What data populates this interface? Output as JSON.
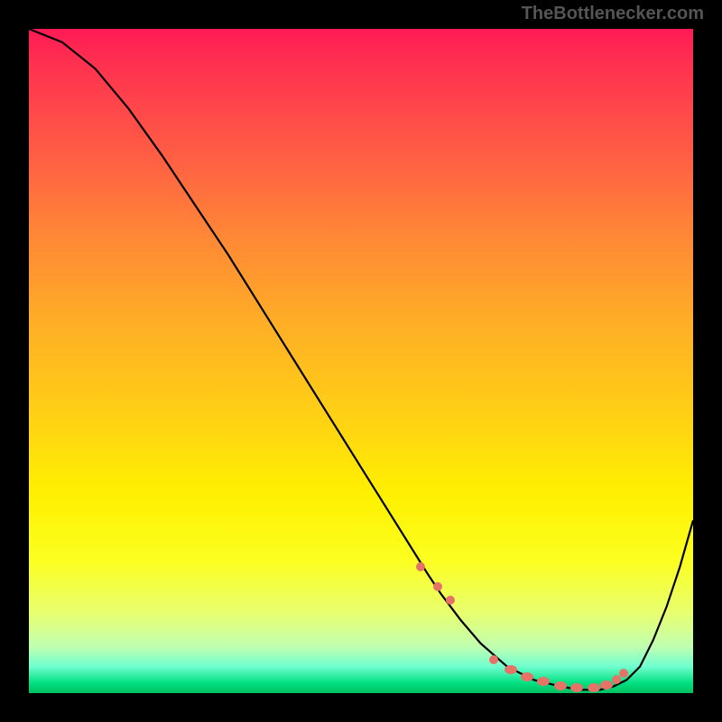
{
  "watermark": "TheBottlenecker.com",
  "chart_data": {
    "type": "line",
    "title": "",
    "xlabel": "",
    "ylabel": "",
    "xlim": [
      0,
      100
    ],
    "ylim": [
      0,
      100
    ],
    "note": "Axis values are normalized 0–100; y=0 is the bottom green band (optimal), y=100 is the top. x spans the full width.",
    "series": [
      {
        "name": "curve",
        "x": [
          0,
          5,
          10,
          15,
          20,
          25,
          30,
          35,
          40,
          45,
          50,
          55,
          60,
          62,
          65,
          68,
          72,
          76,
          80,
          83,
          86,
          88,
          90,
          92,
          94,
          96,
          98,
          100
        ],
        "y": [
          100,
          98,
          94,
          88,
          81,
          73.5,
          66,
          58,
          50,
          42,
          34,
          26,
          18,
          15,
          11,
          7.5,
          4,
          2,
          1,
          0.5,
          0.5,
          1,
          2,
          4,
          8,
          13,
          19,
          26
        ]
      }
    ],
    "highlight_points": {
      "name": "dots",
      "x": [
        59,
        61.5,
        63.5,
        70,
        72.5,
        75,
        77.5,
        80,
        82.5,
        85,
        87,
        88.5,
        89.5
      ],
      "y": [
        19,
        16,
        14,
        5,
        3.5,
        2.5,
        1.7,
        1.1,
        0.8,
        0.8,
        1.2,
        2,
        3
      ]
    },
    "background_gradient": {
      "top": "#ff1a55",
      "middle": "#fff000",
      "bottom": "#00c060"
    }
  }
}
